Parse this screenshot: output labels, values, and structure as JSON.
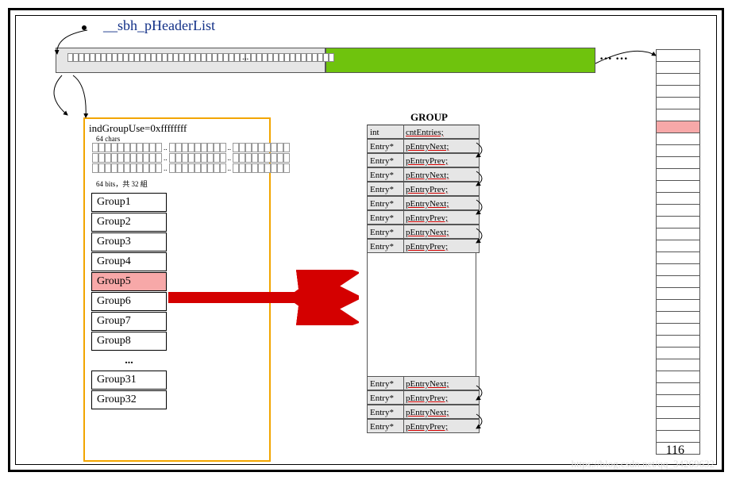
{
  "header_label": "__sbh_pHeaderList",
  "strip_dots": "··· ···",
  "ind_label": "indGroupUse=0xffffffff",
  "chars_label": "64 chars",
  "bits_label": "64 bits，共 32 組",
  "groups_top": [
    "Group1",
    "Group2",
    "Group3",
    "Group4",
    "Group5",
    "Group6",
    "Group7",
    "Group8"
  ],
  "groups_ellipsis": "...",
  "groups_bottom": [
    "Group31",
    "Group32"
  ],
  "highlight_group_index": 4,
  "group_struct_title": "GROUP",
  "struct_first": {
    "type": "int",
    "field": "cntEntries;"
  },
  "struct_pairs_top": [
    {
      "next": {
        "type": "Entry*",
        "field": "pEntryNext;"
      },
      "prev": {
        "type": "Entry*",
        "field": "pEntryPrev;"
      }
    },
    {
      "next": {
        "type": "Entry*",
        "field": "pEntryNext;"
      },
      "prev": {
        "type": "Entry*",
        "field": "pEntryPrev;"
      }
    },
    {
      "next": {
        "type": "Entry*",
        "field": "pEntryNext;"
      },
      "prev": {
        "type": "Entry*",
        "field": "pEntryPrev;"
      }
    },
    {
      "next": {
        "type": "Entry*",
        "field": "pEntryNext;"
      },
      "prev": {
        "type": "Entry*",
        "field": "pEntryPrev;"
      }
    }
  ],
  "struct_pairs_bottom": [
    {
      "next": {
        "type": "Entry*",
        "field": "pEntryNext;"
      },
      "prev": {
        "type": "Entry*",
        "field": "pEntryPrev;"
      }
    },
    {
      "next": {
        "type": "Entry*",
        "field": "pEntryNext;"
      },
      "prev": {
        "type": "Entry*",
        "field": "pEntryPrev;"
      }
    }
  ],
  "right_bar_rows": 34,
  "right_bar_highlight": 6,
  "page_number": "116",
  "watermark": "https://blog.csdn.net/qq_34269632"
}
